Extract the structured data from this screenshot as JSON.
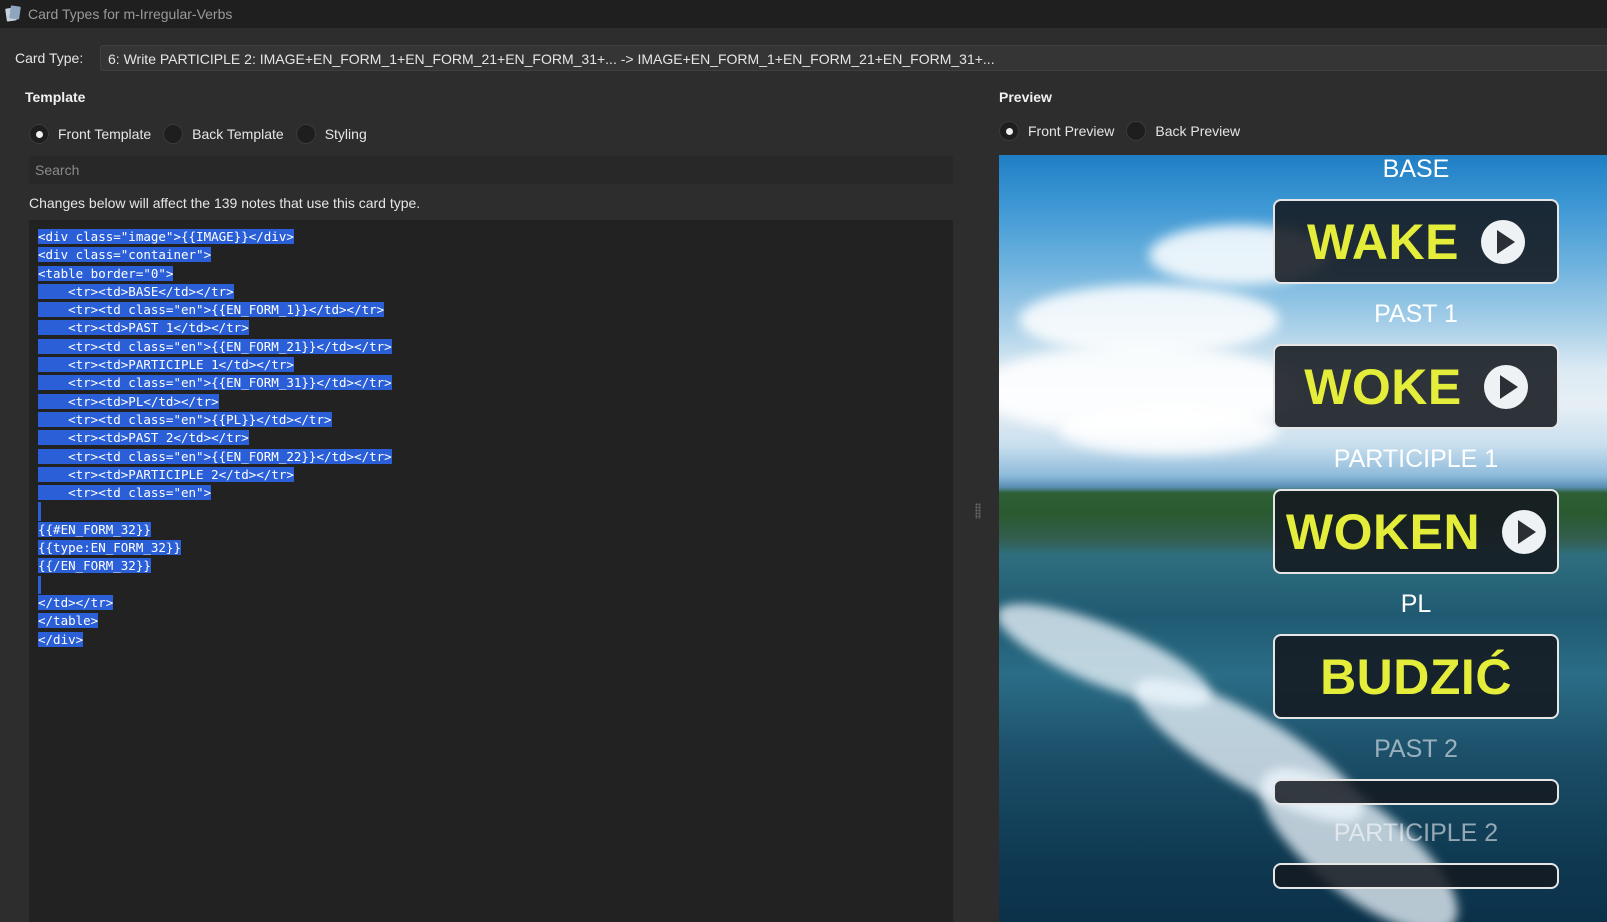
{
  "window": {
    "title": "Card Types for m-Irregular-Verbs"
  },
  "card_type": {
    "label": "Card Type:",
    "value": "6: Write PARTICIPLE 2: IMAGE+EN_FORM_1+EN_FORM_21+EN_FORM_31+... -> IMAGE+EN_FORM_1+EN_FORM_21+EN_FORM_31+..."
  },
  "template": {
    "title": "Template",
    "options": [
      "Front Template",
      "Back Template",
      "Styling"
    ],
    "selected": "Front Template",
    "search_placeholder": "Search",
    "notice": "Changes below will affect the 139 notes that use this card type.",
    "code_lines": [
      "<div class=\"image\">{{IMAGE}}</div>",
      "<div class=\"container\">",
      "<table border=\"0\">",
      "    <tr><td>BASE</td></tr>",
      "    <tr><td class=\"en\">{{EN_FORM_1}}</td></tr>",
      "    <tr><td>PAST 1</td></tr>",
      "    <tr><td class=\"en\">{{EN_FORM_21}}</td></tr>",
      "    <tr><td>PARTICIPLE 1</td></tr>",
      "    <tr><td class=\"en\">{{EN_FORM_31}}</td></tr>",
      "    <tr><td>PL</td></tr>",
      "    <tr><td class=\"en\">{{PL}}</td></tr>",
      "    <tr><td>PAST 2</td></tr>",
      "    <tr><td class=\"en\">{{EN_FORM_22}}</td></tr>",
      "    <tr><td>PARTICIPLE 2</td></tr>",
      "    <tr><td class=\"en\">",
      "",
      "{{#EN_FORM_32}}",
      "{{type:EN_FORM_32}}",
      "{{/EN_FORM_32}}",
      "",
      "</td></tr>",
      "</table>",
      "</div>"
    ]
  },
  "preview": {
    "title": "Preview",
    "options": [
      "Front Preview",
      "Back Preview"
    ],
    "selected": "Front Preview",
    "fields": [
      {
        "label": "BASE",
        "word": "WAKE",
        "audio": true
      },
      {
        "label": "PAST 1",
        "word": "WOKE",
        "audio": true
      },
      {
        "label": "PARTICIPLE 1",
        "word": "WOKEN",
        "audio": true
      },
      {
        "label": "PL",
        "word": "BUDZIĆ",
        "audio": false
      },
      {
        "label": "PAST 2",
        "word": "",
        "audio": false
      },
      {
        "label": "PARTICIPLE 2",
        "word": "",
        "audio": false
      }
    ]
  },
  "colors": {
    "background": "#2d2d2d",
    "selection": "#2a5fd8",
    "word_text": "#e4ee3a"
  }
}
